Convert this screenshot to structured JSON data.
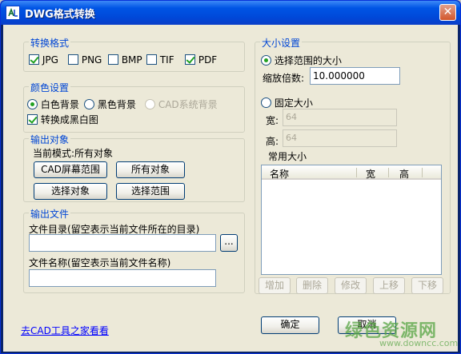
{
  "window": {
    "title": "DWG格式转换",
    "close_symbol": "✕",
    "icon": "dwg-app-icon"
  },
  "format_group": {
    "title": "转换格式",
    "options": [
      {
        "label": "JPG",
        "checked": true
      },
      {
        "label": "PNG",
        "checked": false
      },
      {
        "label": "BMP",
        "checked": false
      },
      {
        "label": "TIF",
        "checked": false
      },
      {
        "label": "PDF",
        "checked": true
      }
    ]
  },
  "color_group": {
    "title": "颜色设置",
    "radios": [
      {
        "label": "白色背景",
        "selected": true,
        "enabled": true
      },
      {
        "label": "黑色背景",
        "selected": false,
        "enabled": true
      },
      {
        "label": "CAD系统背景",
        "selected": false,
        "enabled": false
      }
    ],
    "bw_checkbox": {
      "label": "转换成黑白图",
      "checked": true
    }
  },
  "output_object": {
    "title": "输出对象",
    "mode_text": "当前模式:所有对象",
    "buttons": [
      "CAD屏幕范围",
      "所有对象",
      "选择对象",
      "选择范围"
    ]
  },
  "output_file": {
    "title": "输出文件",
    "dir_label": "文件目录(留空表示当前文件所在的目录)",
    "dir_value": "",
    "browse_label": "...",
    "name_label": "文件名称(留空表示当前文件名称)",
    "name_value": ""
  },
  "size_group": {
    "title": "大小设置",
    "select_range_label": "选择范围的大小",
    "scale_label": "缩放倍数:",
    "scale_value": "10.000000",
    "fixed_size_label": "固定大小",
    "width_label": "宽:",
    "width_value": "64",
    "height_label": "高:",
    "height_value": "64",
    "common_sizes_label": "常用大小",
    "columns": [
      "名称",
      "宽",
      "高"
    ],
    "buttons": [
      "增加",
      "删除",
      "修改",
      "上移",
      "下移"
    ]
  },
  "footer": {
    "link_text": "去CAD工具之家看看",
    "ok_label": "确定",
    "cancel_label": "取消"
  },
  "watermark": {
    "line1": "绿色资源网",
    "line2": "www.downcc.com"
  },
  "colors": {
    "title_bar": "#0055e5",
    "group_title": "#0046d5",
    "dialog_bg": "#ece9d8",
    "link": "#0000ff"
  }
}
